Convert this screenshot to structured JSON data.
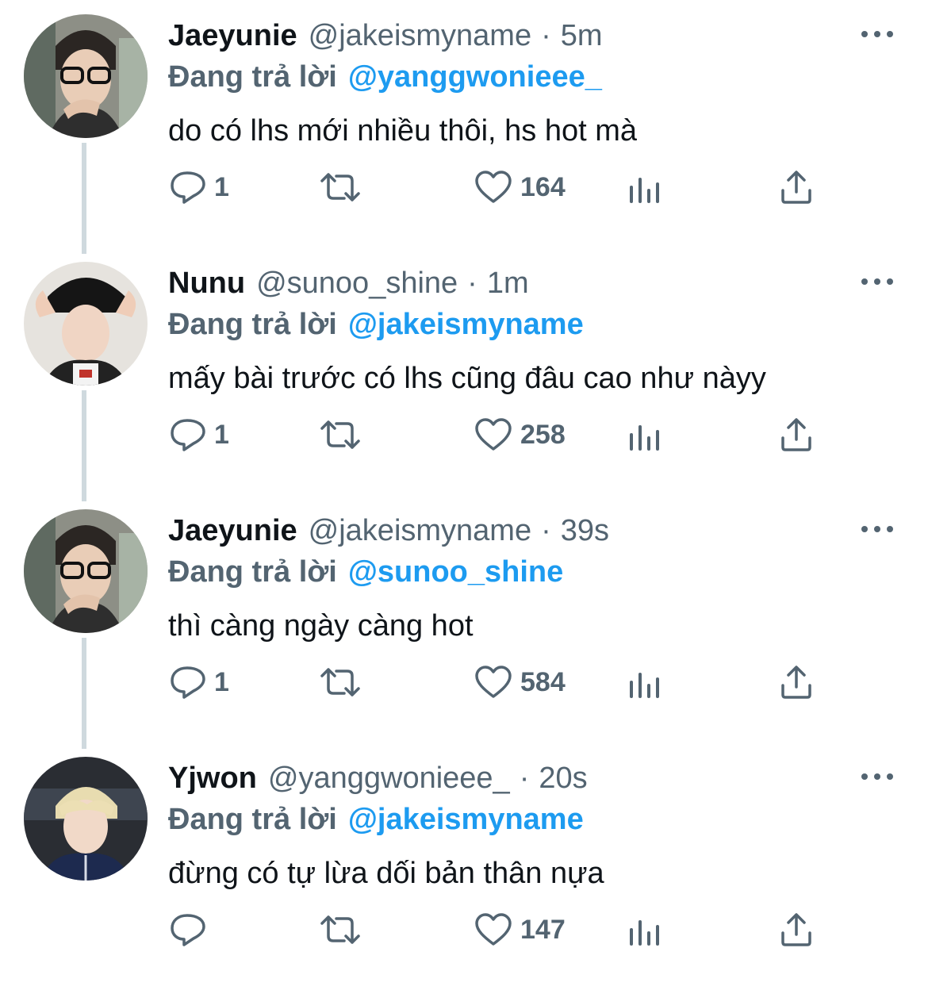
{
  "reply_prefix": "Đang trả lời",
  "colors": {
    "link": "#1d9bf0",
    "muted": "#536471",
    "text": "#0f1419",
    "thread_line": "#cfd9de"
  },
  "tweets": [
    {
      "display_name": "Jaeyunie",
      "handle": "@jakeismyname",
      "separator": "·",
      "time": "5m",
      "reply_to": "@yanggwonieee_",
      "text": "do có lhs mới nhiều thôi, hs hot mà",
      "reply_count": "1",
      "like_count": "164"
    },
    {
      "display_name": "Nunu",
      "handle": "@sunoo_shine",
      "separator": "·",
      "time": "1m",
      "reply_to": "@jakeismyname",
      "text": "mấy bài trước có lhs cũng đâu cao như nàyy",
      "reply_count": "1",
      "like_count": "258"
    },
    {
      "display_name": "Jaeyunie",
      "handle": "@jakeismyname",
      "separator": "·",
      "time": "39s",
      "reply_to": "@sunoo_shine",
      "text": "thì càng ngày càng hot",
      "reply_count": "1",
      "like_count": "584"
    },
    {
      "display_name": "Yjwon",
      "handle": "@yanggwonieee_",
      "separator": "·",
      "time": "20s",
      "reply_to": "@jakeismyname",
      "text": "đừng có tự lừa dối bản thân nựa",
      "reply_count": "",
      "like_count": "147"
    }
  ]
}
